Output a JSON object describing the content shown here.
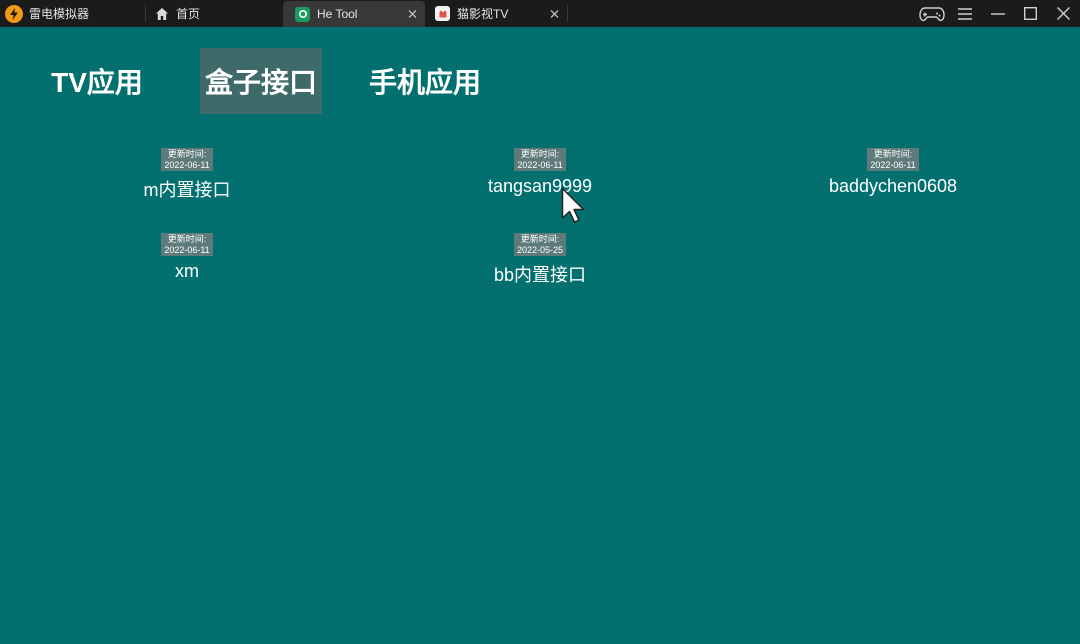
{
  "app": {
    "name": "雷电模拟器"
  },
  "tabs": [
    {
      "label": "首页",
      "icon": "home-icon"
    },
    {
      "label": "He Tool",
      "icon": "he-tool-app-icon",
      "active": true
    },
    {
      "label": "猫影视TV",
      "icon": "maoyingshi-app-icon"
    }
  ],
  "window_controls": [
    "gamepad-icon",
    "menu-icon",
    "minimize-icon",
    "maximize-icon",
    "close-icon"
  ],
  "nav": {
    "tv_apps": "TV应用",
    "box_interfaces": "盒子接口",
    "phone_apps": "手机应用",
    "selected": "盒子接口"
  },
  "interfaces": [
    {
      "update_label": "更新时间:",
      "update_date": "2022-06-11",
      "name": "m内置接口"
    },
    {
      "update_label": "更新时间:",
      "update_date": "2022-06-11",
      "name": "tangsan9999"
    },
    {
      "update_label": "更新时间:",
      "update_date": "2022-06-11",
      "name": "baddychen0608"
    },
    {
      "update_label": "更新时间:",
      "update_date": "2022-06-11",
      "name": "xm"
    },
    {
      "update_label": "更新时间:",
      "update_date": "2022-05-25",
      "name": "bb内置接口"
    }
  ],
  "colors": {
    "background": "#036f6f",
    "titlebar": "#1b1b1b",
    "selected_nav": "#3e6a6a",
    "badge": "#5f7a7a",
    "brand_accent": "#f29a17"
  }
}
